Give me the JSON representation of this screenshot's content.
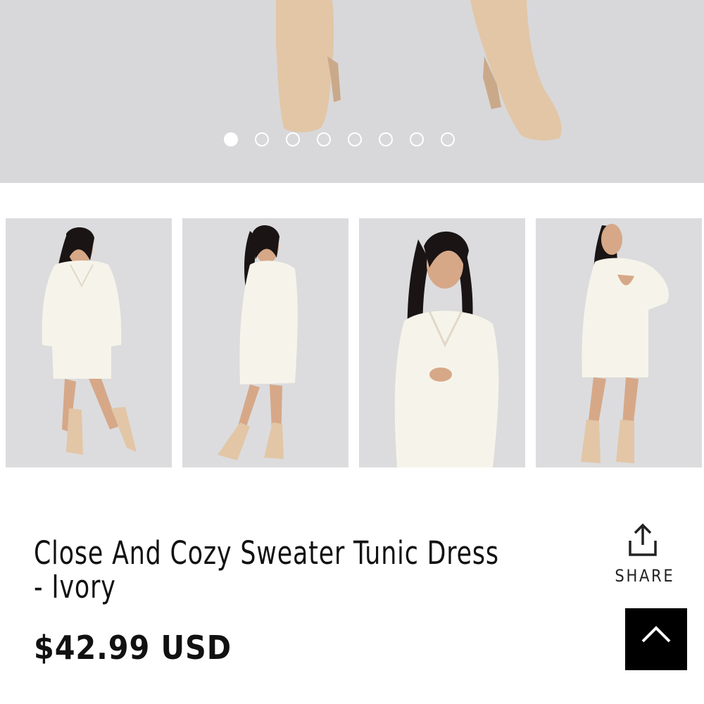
{
  "hero": {
    "slide_count": 8,
    "active_slide": 1
  },
  "thumbnails": [
    {
      "name": "front-view"
    },
    {
      "name": "side-view"
    },
    {
      "name": "closeup-view"
    },
    {
      "name": "back-view"
    }
  ],
  "product": {
    "title": "Close And Cozy Sweater Tunic Dress - Ivory",
    "price": "$42.99 USD"
  },
  "actions": {
    "share_label": "SHARE",
    "share_icon": "share-icon",
    "back_to_top_icon": "chevron-up-icon"
  },
  "colors": {
    "background": "#ffffff",
    "image_backdrop": "#d8d8da",
    "boot": "#e0c4a4",
    "dress": "#f6f4ea",
    "text": "#111111",
    "button": "#000000"
  }
}
